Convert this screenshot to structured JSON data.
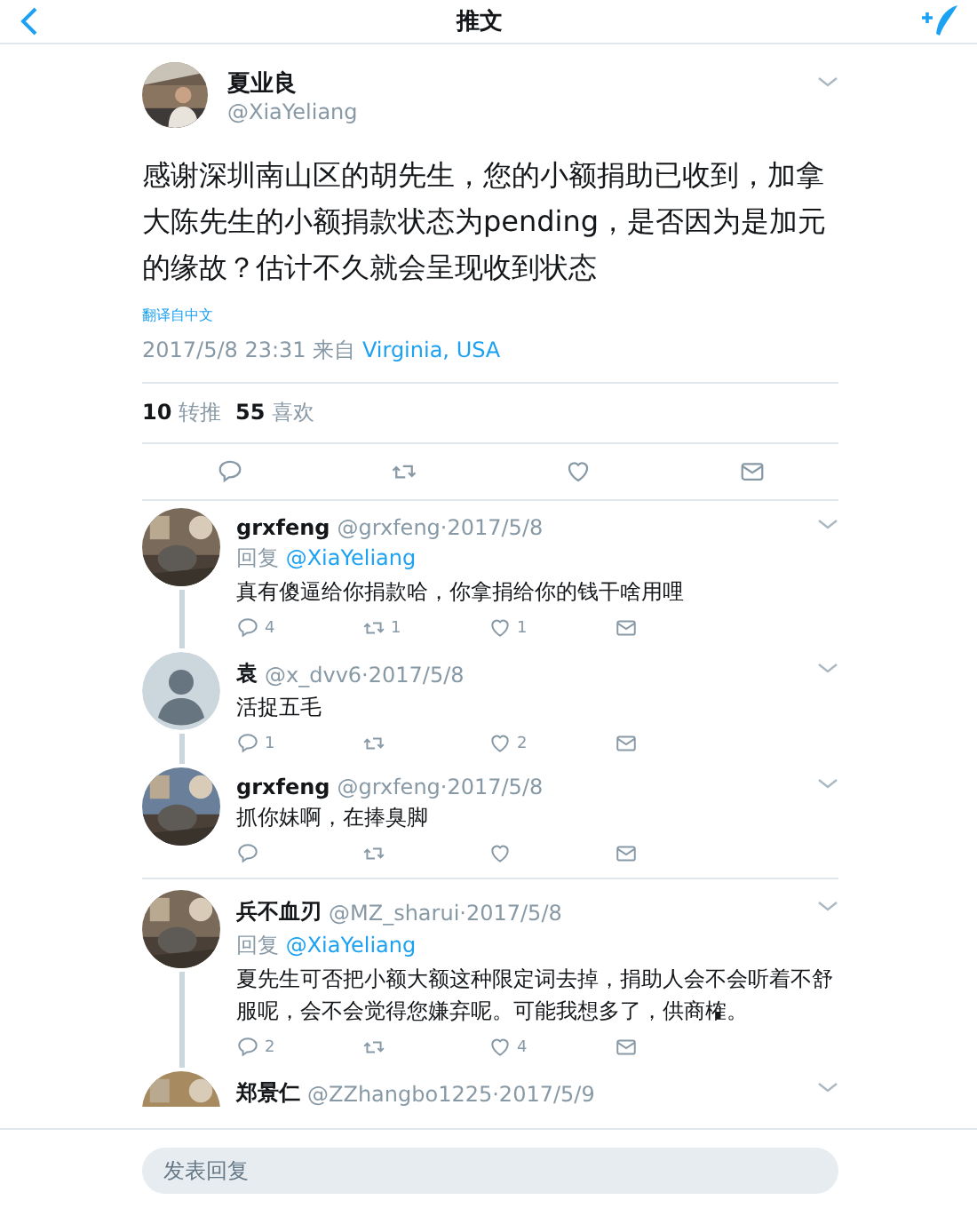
{
  "header": {
    "title": "推文"
  },
  "tweet": {
    "name": "夏业良",
    "handle": "@XiaYeliang",
    "text": "感谢深圳南山区的胡先生，您的小额捐助已收到，加拿大陈先生的小额捐款状态为pending，是否因为是加元的缘故？估计不久就会呈现收到状态",
    "translate": "翻译自中文",
    "time": "2017/5/8 23:31 来自",
    "place": "Virginia, USA",
    "retweets": "10",
    "retweets_label": "转推",
    "likes": "55",
    "likes_label": "喜欢"
  },
  "replies": [
    {
      "name": "grxfeng",
      "meta": "@grxfeng·2017/5/8",
      "reply_label": "回复",
      "reply_to": "@XiaYeliang",
      "text": "真有傻逼给你捐款哈，你拿捐给你的钱干啥用哩",
      "counts": {
        "reply": "4",
        "retweet": "1",
        "like": "1"
      }
    },
    {
      "name": "袁",
      "meta": "@x_dvv6·2017/5/8",
      "avatar": {
        "kind": "default"
      },
      "text": "活捉五毛",
      "counts": {
        "reply": "1",
        "like": "2"
      }
    },
    {
      "name": "grxfeng",
      "meta": "@grxfeng·2017/5/8",
      "text": "抓你妹啊，在捧臭脚"
    },
    {
      "name": "兵不血刃",
      "meta": "@MZ_sharui·2017/5/8",
      "reply_label": "回复",
      "reply_to": "@XiaYeliang",
      "text": "夏先生可否把小额大额这种限定词去掉，捐助人会不会听着不舒服呢，会不会觉得您嫌弃呢。可能我想多了，供商榷。",
      "counts": {
        "reply": "2",
        "like": "4"
      }
    },
    {
      "name": "郑景仁",
      "meta": "@ZZhangbo1225·2017/5/9"
    }
  ],
  "composer": {
    "placeholder": "发表回复"
  }
}
